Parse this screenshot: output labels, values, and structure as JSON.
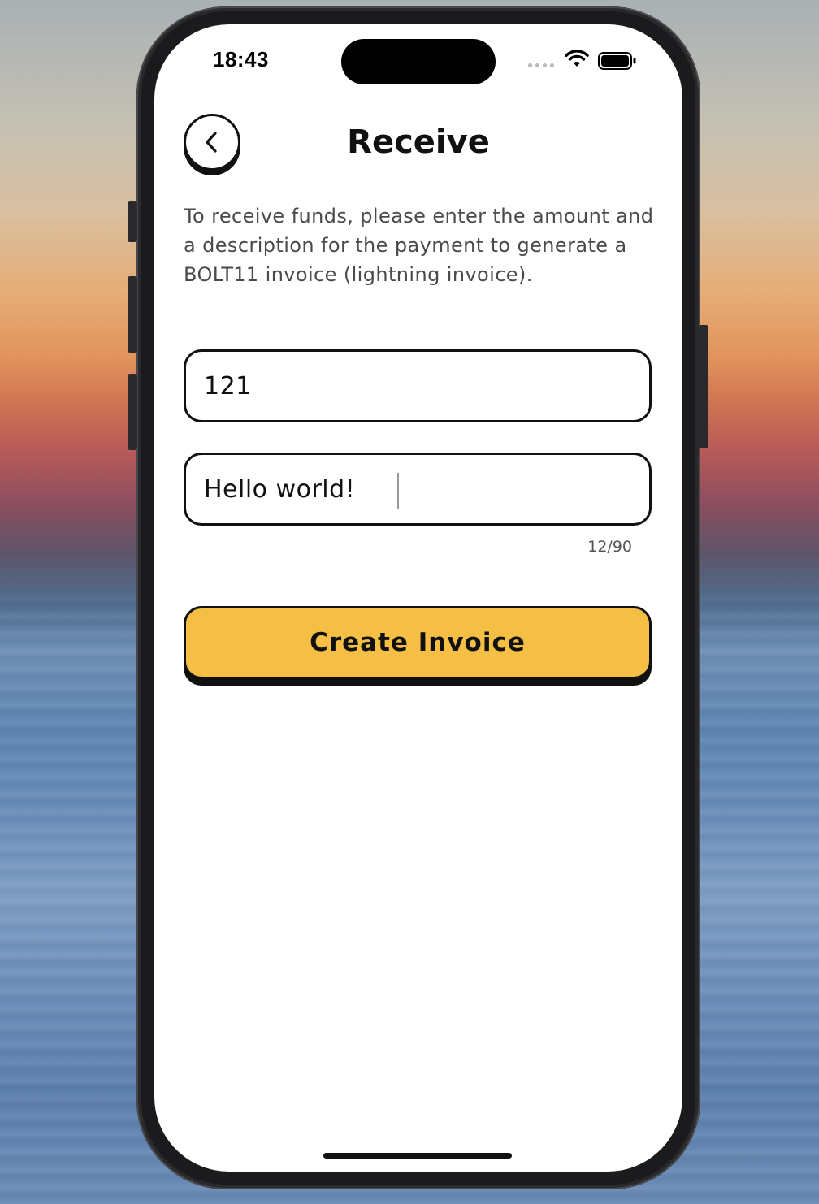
{
  "status_bar": {
    "time": "18:43"
  },
  "header": {
    "title": "Receive"
  },
  "description": "To receive funds, please enter the amount and a description for the payment to generate a BOLT11 invoice (lightning invoice).",
  "amount_field": {
    "value": "121"
  },
  "description_field": {
    "value": "Hello world!",
    "counter": "12/90"
  },
  "create_button": {
    "label": "Create Invoice"
  },
  "colors": {
    "accent": "#f5bf45",
    "border": "#111111",
    "background": "#ffffff"
  },
  "icons": [
    "back-chevron-icon",
    "wifi-icon",
    "battery-icon",
    "cellular-signal-icon"
  ]
}
